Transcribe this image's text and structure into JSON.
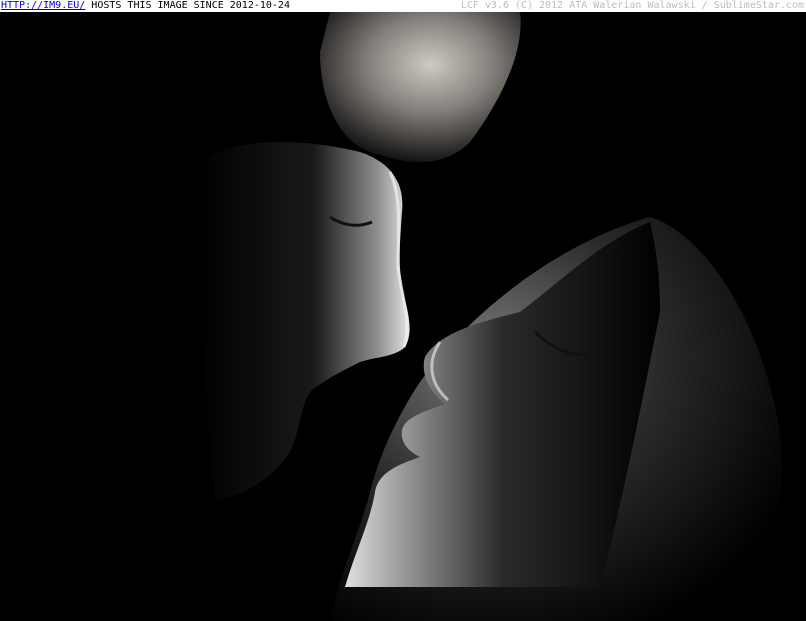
{
  "banner": {
    "link_text": "HTTP://IM9.EU/",
    "host_text": "HOSTS THIS IMAGE SINCE 2012-10-24",
    "credit_text": "LCF v3.6 (C) 2012 ATA Walerian Walawski / SublimeStar.com"
  },
  "colors": {
    "background": "#000000",
    "banner_background": "#ffffff",
    "link": "#0000ee",
    "credit": "#bdbdbd"
  }
}
